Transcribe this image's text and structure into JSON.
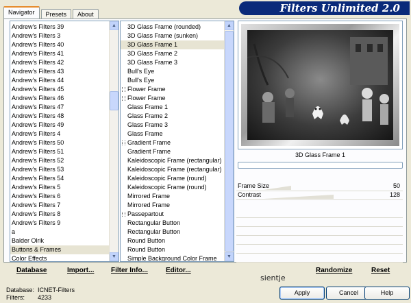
{
  "tabs": [
    "Navigator",
    "Presets",
    "About"
  ],
  "banner_title": "Filters Unlimited 2.0",
  "categories": [
    "Andrew's Filters 39",
    "Andrew's Filters 3",
    "Andrew's Filters 40",
    "Andrew's Filters 41",
    "Andrew's Filters 42",
    "Andrew's Filters 43",
    "Andrew's Filters 44",
    "Andrew's Filters 45",
    "Andrew's Filters 46",
    "Andrew's Filters 47",
    "Andrew's Filters 48",
    "Andrew's Filters 49",
    "Andrew's Filters 4",
    "Andrew's Filters 50",
    "Andrew's Filters 51",
    "Andrew's Filters 52",
    "Andrew's Filters 53",
    "Andrew's Filters 54",
    "Andrew's Filters 5",
    "Andrew's Filters 6",
    "Andrew's Filters 7",
    "Andrew's Filters 8",
    "Andrew's Filters 9",
    "a",
    "Balder Olrik",
    "Buttons & Frames",
    "Color Effects"
  ],
  "categories_selected_index": 25,
  "filters": [
    {
      "label": "3D Glass Frame (rounded)",
      "kind": "normal"
    },
    {
      "label": "3D Glass Frame (sunken)",
      "kind": "normal"
    },
    {
      "label": "3D Glass Frame 1",
      "kind": "selected"
    },
    {
      "label": "3D Glass Frame 2",
      "kind": "normal"
    },
    {
      "label": "3D Glass Frame 3",
      "kind": "normal"
    },
    {
      "label": "Bull's Eye",
      "kind": "normal"
    },
    {
      "label": "Bull's Eye",
      "kind": "normal"
    },
    {
      "label": "Flower Frame",
      "kind": "marked"
    },
    {
      "label": "Flower Frame",
      "kind": "marked"
    },
    {
      "label": "Glass Frame 1",
      "kind": "normal"
    },
    {
      "label": "Glass Frame 2",
      "kind": "normal"
    },
    {
      "label": "Glass Frame 3",
      "kind": "normal"
    },
    {
      "label": "Glass Frame",
      "kind": "normal"
    },
    {
      "label": "Gradient Frame",
      "kind": "marked"
    },
    {
      "label": "Gradient Frame",
      "kind": "normal"
    },
    {
      "label": "Kaleidoscopic Frame (rectangular)",
      "kind": "normal"
    },
    {
      "label": "Kaleidoscopic Frame (rectangular)",
      "kind": "normal"
    },
    {
      "label": "Kaleidoscopic Frame (round)",
      "kind": "normal"
    },
    {
      "label": "Kaleidoscopic Frame (round)",
      "kind": "normal"
    },
    {
      "label": "Mirrored Frame",
      "kind": "normal"
    },
    {
      "label": "Mirrored Frame",
      "kind": "normal"
    },
    {
      "label": "Passepartout",
      "kind": "marked"
    },
    {
      "label": "Rectangular Button",
      "kind": "normal"
    },
    {
      "label": "Rectangular Button",
      "kind": "normal"
    },
    {
      "label": "Round Button",
      "kind": "normal"
    },
    {
      "label": "Round Button",
      "kind": "normal"
    },
    {
      "label": "Simple Background Color Frame",
      "kind": "normal"
    }
  ],
  "preview_caption": "3D Glass Frame 1",
  "parameters": [
    {
      "label": "Frame Size",
      "value": "50",
      "level": 0.196
    },
    {
      "label": "Contrast",
      "value": "128",
      "level": 0.502
    }
  ],
  "bottom_buttons": {
    "database": "Database",
    "import": "Import...",
    "filter_info": "Filter Info...",
    "editor": "Editor...",
    "randomize": "Randomize",
    "reset": "Reset"
  },
  "signature": "sientje",
  "status": {
    "database_label": "Database:",
    "database_value": "ICNET-Filters",
    "filters_label": "Filters:",
    "filters_value": "4233"
  },
  "dialog_buttons": {
    "apply": "Apply",
    "cancel": "Cancel",
    "help": "Help"
  },
  "colors": {
    "banner": "#0a2a7a",
    "selection": "#e7e4d3",
    "tab_accent": "#e68b2c"
  }
}
